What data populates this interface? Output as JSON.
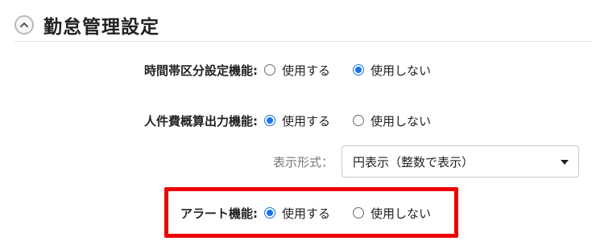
{
  "section": {
    "title": "勤怠管理設定",
    "collapse_icon": "chevron-up-icon"
  },
  "rows": {
    "time_zone": {
      "label": "時間帯区分設定機能:",
      "options": [
        {
          "label": "使用する",
          "checked": false
        },
        {
          "label": "使用しない",
          "checked": true
        }
      ]
    },
    "labor_cost": {
      "label": "人件費概算出力機能:",
      "options": [
        {
          "label": "使用する",
          "checked": true
        },
        {
          "label": "使用しない",
          "checked": false
        }
      ]
    },
    "display_format": {
      "label": "表示形式：",
      "selected": "円表示（整数で表示）"
    },
    "alert": {
      "label": "アラート機能:",
      "options": [
        {
          "label": "使用する",
          "checked": true
        },
        {
          "label": "使用しない",
          "checked": false
        }
      ]
    }
  },
  "colors": {
    "radio_checked": "#1a73e8",
    "highlight": "#ee0000"
  }
}
